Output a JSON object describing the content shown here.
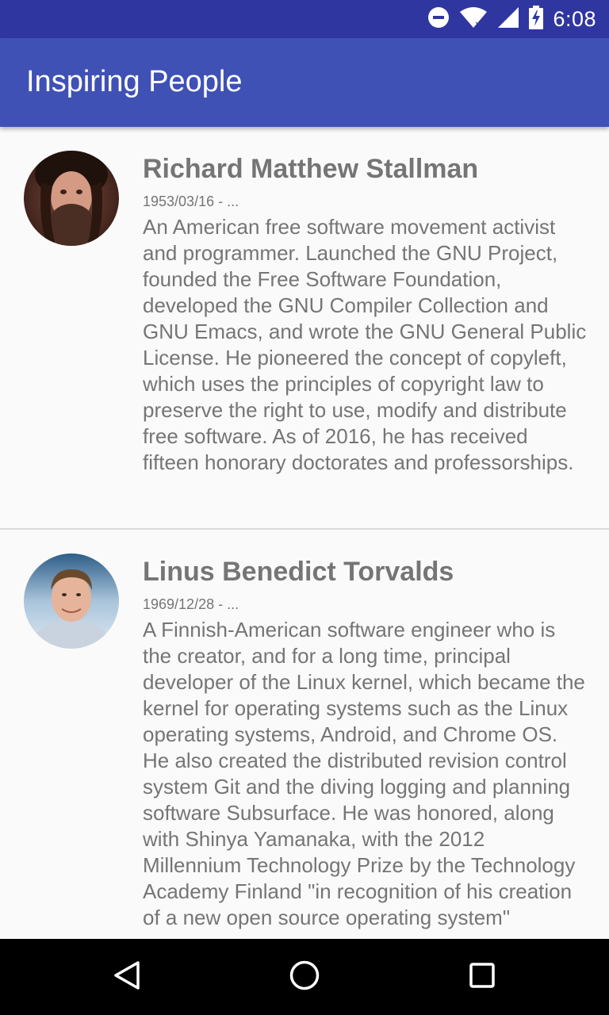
{
  "status_bar": {
    "time": "6:08",
    "icons": [
      "do-not-disturb-icon",
      "wifi-icon",
      "signal-icon",
      "battery-charging-icon"
    ]
  },
  "app_bar": {
    "title": "Inspiring People"
  },
  "people": [
    {
      "name": "Richard Matthew Stallman",
      "dates": "1953/03/16 - ...",
      "bio": "An American free software movement activist and programmer. Launched the GNU Project, founded the Free Software Foundation, developed the GNU Compiler Collection and GNU Emacs, and wrote the GNU General Public License. He pioneered the concept of copyleft, which uses the principles of copyright law to preserve the right to use, modify and distribute free software. As of 2016, he has received fifteen honorary doctorates and professorships."
    },
    {
      "name": "Linus Benedict Torvalds",
      "dates": "1969/12/28 - ...",
      "bio": "A Finnish-American software engineer who is the creator, and for a long time, principal developer of the Linux kernel, which became the kernel for operating systems such as the Linux operating systems, Android, and Chrome OS. He also created the distributed revision control system Git and the diving logging and planning software Subsurface. He was honored, along with Shinya Yamanaka, with the 2012 Millennium Technology Prize by the Technology Academy Finland \"in recognition of his creation of a new open source operating system\""
    }
  ],
  "nav_bar": {
    "icons": [
      "back-icon",
      "home-icon",
      "recents-icon"
    ]
  },
  "colors": {
    "status_bar": "#3036a0",
    "app_bar": "#3f51b5",
    "text": "#757575",
    "divider": "#dcdcdc"
  }
}
